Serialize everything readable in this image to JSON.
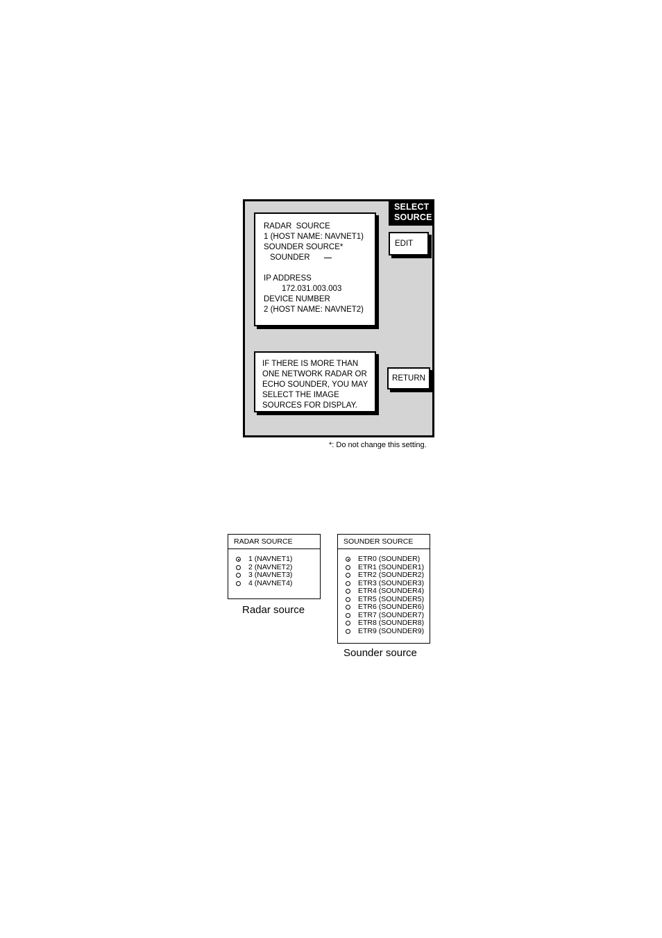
{
  "device_screen": {
    "header_label": "SELECT\nSOURCE",
    "header_line1": "SELECT",
    "header_line2": "SOURCE",
    "softkeys": {
      "edit": "EDIT",
      "return": "RETURN"
    },
    "status_box": {
      "lines": [
        {
          "text": "RADAR  SOURCE",
          "indent": 0
        },
        {
          "text": "1 (HOST NAME: NAVNET1)",
          "indent": 0
        },
        {
          "text": "SOUNDER SOURCE*",
          "indent": 0
        },
        {
          "text": "SOUNDER",
          "indent": 1,
          "cursor": true
        },
        {
          "text": "",
          "indent": 0,
          "blank": true
        },
        {
          "text": "IP ADDRESS",
          "indent": 0
        },
        {
          "text": "172.031.003.003",
          "indent": 2
        },
        {
          "text": "DEVICE NUMBER",
          "indent": 0
        },
        {
          "text": "2 (HOST NAME: NAVNET2)",
          "indent": 0
        }
      ],
      "radar_source_label": "RADAR  SOURCE",
      "radar_source_value": "1 (HOST NAME: NAVNET1)",
      "sounder_source_label": "SOUNDER SOURCE*",
      "sounder_source_value": "SOUNDER",
      "ip_address_label": "IP ADDRESS",
      "ip_address_value": "172.031.003.003",
      "device_number_label": "DEVICE NUMBER",
      "device_number_value": "2 (HOST NAME: NAVNET2)"
    },
    "help_box": {
      "lines": [
        "IF THERE IS MORE THAN",
        "ONE NETWORK RADAR OR",
        "ECHO SOUNDER, YOU MAY",
        "SELECT THE IMAGE",
        "SOURCES FOR DISPLAY."
      ]
    }
  },
  "footnote": "*: Do not change this setting.",
  "radar_source_box": {
    "title": "RADAR SOURCE",
    "caption": "Radar source",
    "items": [
      {
        "label": "1 (NAVNET1)",
        "selected": true
      },
      {
        "label": "2 (NAVNET2)",
        "selected": false
      },
      {
        "label": "3 (NAVNET3)",
        "selected": false
      },
      {
        "label": "4 (NAVNET4)",
        "selected": false
      }
    ]
  },
  "sounder_source_box": {
    "title": "SOUNDER SOURCE",
    "caption": "Sounder source",
    "items": [
      {
        "label": "ETR0 (SOUNDER)",
        "selected": true
      },
      {
        "label": "ETR1 (SOUNDER1)",
        "selected": false
      },
      {
        "label": "ETR2 (SOUNDER2)",
        "selected": false
      },
      {
        "label": "ETR3 (SOUNDER3)",
        "selected": false
      },
      {
        "label": "ETR4 (SOUNDER4)",
        "selected": false
      },
      {
        "label": "ETR5 (SOUNDER5)",
        "selected": false
      },
      {
        "label": "ETR6 (SOUNDER6)",
        "selected": false
      },
      {
        "label": "ETR7 (SOUNDER7)",
        "selected": false
      },
      {
        "label": "ETR8 (SOUNDER8)",
        "selected": false
      },
      {
        "label": "ETR9 (SOUNDER9)",
        "selected": false
      }
    ]
  },
  "colors": {
    "panel_background": "#d4d4d4",
    "header_background": "#000000",
    "header_text": "#ffffff",
    "box_background": "#ffffff",
    "outline": "#000000"
  }
}
